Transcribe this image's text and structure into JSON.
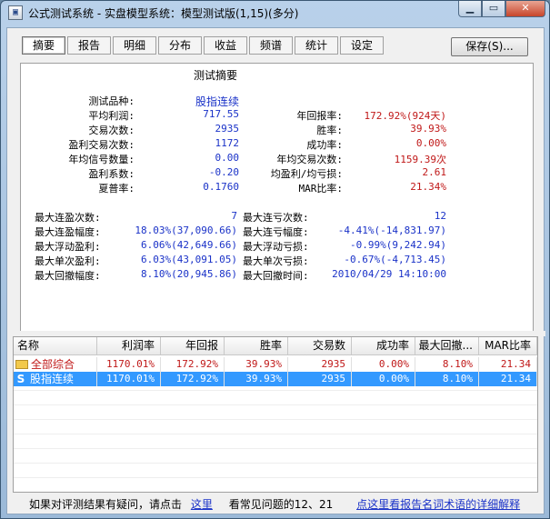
{
  "window": {
    "title": "公式测试系统 - 实盘模型系统：模型测试版(1,15)(多分)"
  },
  "tabs": [
    "摘要",
    "报告",
    "明细",
    "分布",
    "收益",
    "频谱",
    "统计",
    "设定"
  ],
  "save_button": "保存(S)...",
  "summary": {
    "title": "测试摘要",
    "left_labels": [
      "测试品种:",
      "平均利润:",
      "交易次数:",
      "盈利交易次数:",
      "年均信号数量:",
      "盈利系数:",
      "夏普率:"
    ],
    "left_values": [
      "股指连续",
      "717.55",
      "2935",
      "1172",
      "0.00",
      "-0.20",
      "0.1760"
    ],
    "right_labels": [
      "年回报率:",
      "胜率:",
      "成功率:",
      "年均交易次数:",
      "均盈利/均亏损:",
      "MAR比率:"
    ],
    "right_values": [
      "172.92%(924天)",
      "39.93%",
      "0.00%",
      "1159.39次",
      "2.61",
      "21.34%"
    ],
    "stats_left_labels": [
      "最大连盈次数:",
      "最大连盈幅度:",
      "最大浮动盈利:",
      "最大单次盈利:",
      "最大回撤幅度:"
    ],
    "stats_left_values": [
      "7",
      "18.03%(37,090.66)",
      "6.06%(42,649.66)",
      "6.03%(43,091.05)",
      "8.10%(20,945.86)"
    ],
    "stats_right_labels": [
      "最大连亏次数:",
      "最大连亏幅度:",
      "最大浮动亏损:",
      "最大单次亏损:",
      "最大回撤时间:"
    ],
    "stats_right_values": [
      "12",
      "-4.41%(-14,831.97)",
      "-0.99%(9,242.94)",
      "-0.67%(-4,713.45)",
      "2010/04/29 14:10:00"
    ]
  },
  "table": {
    "headers": [
      "名称",
      "利润率",
      "年回报",
      "胜率",
      "交易数",
      "成功率",
      "最大回撤...",
      "MAR比率"
    ],
    "rows": [
      {
        "name": "全部综合",
        "icon": "folder-icon",
        "cells": [
          "1170.01%",
          "172.92%",
          "39.93%",
          "2935",
          "0.00%",
          "8.10%",
          "21.34"
        ]
      },
      {
        "name": "股指连续",
        "icon": "s-icon",
        "cells": [
          "1170.01%",
          "172.92%",
          "39.93%",
          "2935",
          "0.00%",
          "8.10%",
          "21.34"
        ]
      }
    ]
  },
  "status": {
    "text1": "如果对评测结果有疑问，请点击",
    "link1": "这里",
    "text2": "看常见问题的12、21",
    "link2": "点这里看报告名词术语的详细解释"
  }
}
